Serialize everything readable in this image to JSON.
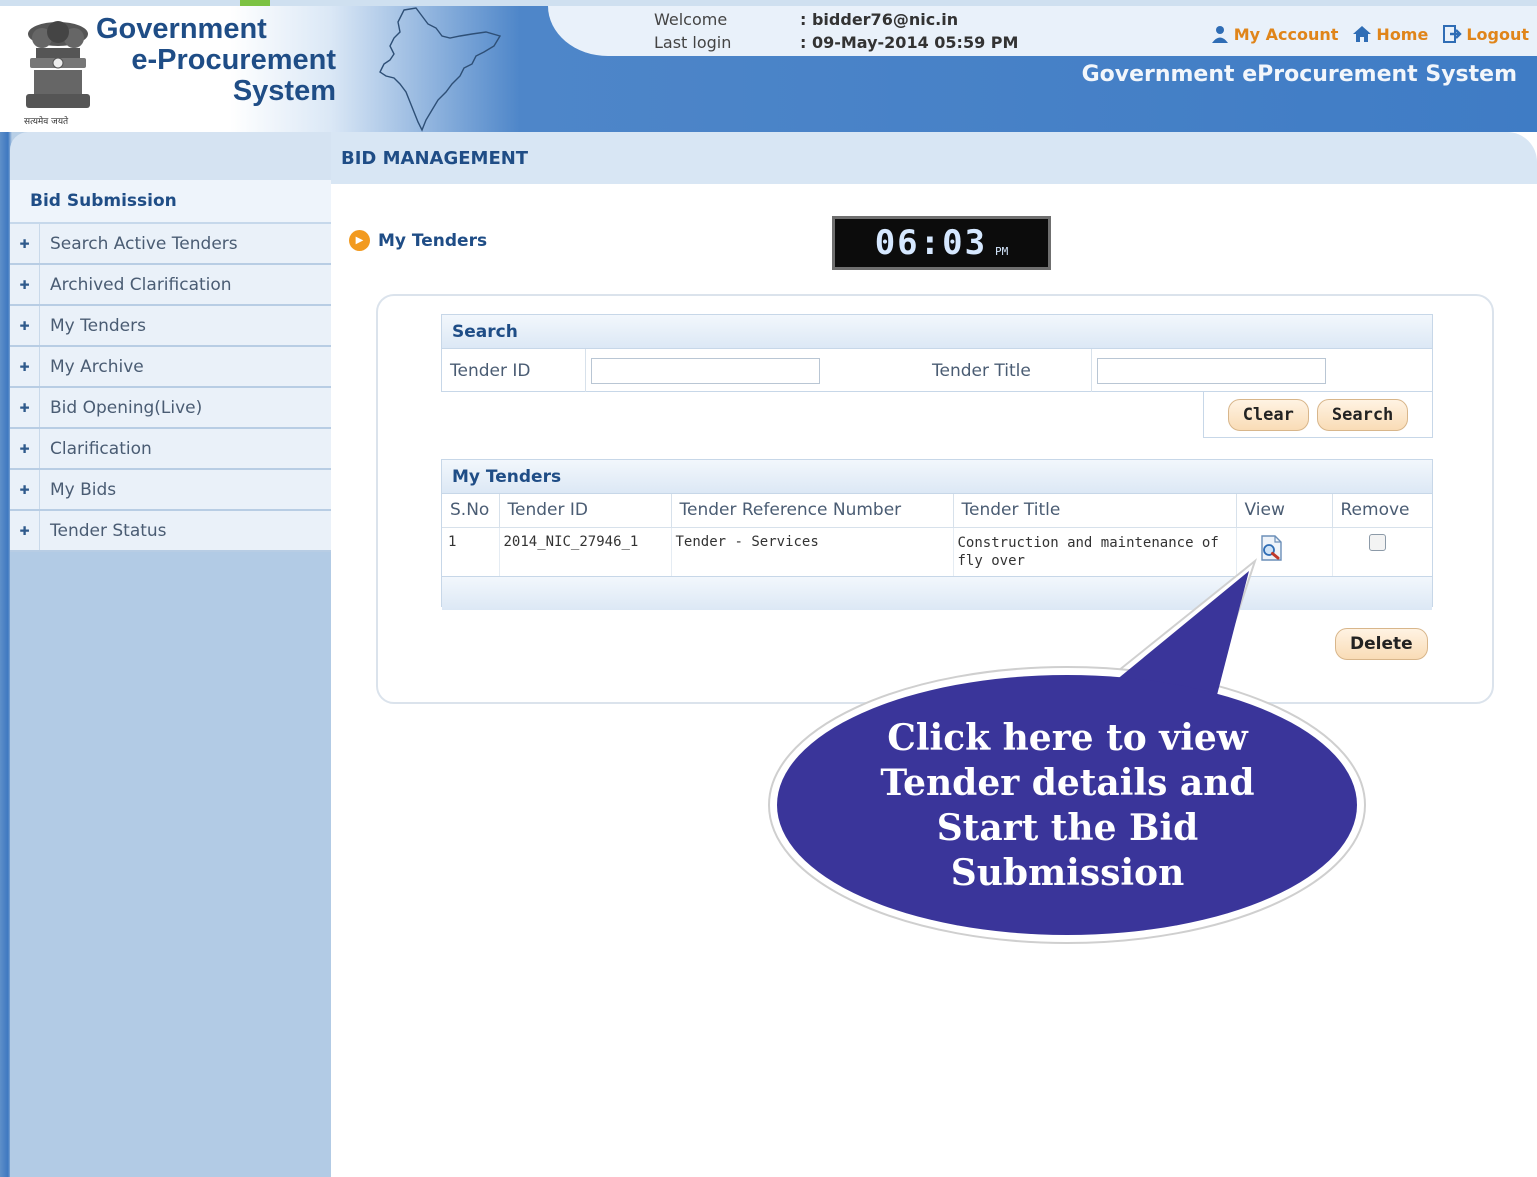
{
  "header": {
    "logo_line1": "Government",
    "logo_line2": "e-Procurement",
    "logo_line3": "System",
    "emblem_motto": "सत्यमेव जयते",
    "welcome_label": "Welcome",
    "welcome_value": ": bidder76@nic.in",
    "last_login_label": "Last login",
    "last_login_value": ": 09-May-2014 05:59 PM",
    "links": {
      "my_account": "My Account",
      "home": "Home",
      "logout": "Logout"
    },
    "system_title": "Government eProcurement System",
    "colors": {
      "link": "#e0851a",
      "brand": "#1f4d86"
    }
  },
  "sidebar": {
    "heading": "Bid Submission",
    "items": [
      {
        "label": "Search Active Tenders"
      },
      {
        "label": "Archived Clarification"
      },
      {
        "label": "My Tenders"
      },
      {
        "label": "My Archive"
      },
      {
        "label": "Bid Opening(Live)"
      },
      {
        "label": "Clarification"
      },
      {
        "label": "My Bids"
      },
      {
        "label": "Tender Status"
      }
    ],
    "bullet_icon": "arrow-right-icon"
  },
  "main": {
    "title": "BID MANAGEMENT",
    "section_title": "My Tenders",
    "clock": {
      "time": "06:03",
      "ampm": "PM"
    },
    "search": {
      "heading": "Search",
      "tender_id_label": "Tender ID",
      "tender_id_value": "",
      "tender_title_label": "Tender Title",
      "tender_title_value": "",
      "clear_label": "Clear",
      "search_label": "Search"
    },
    "tenders": {
      "heading": "My Tenders",
      "columns": [
        "S.No",
        "Tender ID",
        "Tender Reference Number",
        "Tender Title",
        "View",
        "Remove"
      ],
      "rows": [
        {
          "sno": "1",
          "tender_id": "2014_NIC_27946_1",
          "reference": "Tender - Services",
          "title": "Construction and maintenance of fly over",
          "view_icon": "view-document-icon",
          "remove_checked": false
        }
      ],
      "delete_label": "Delete"
    }
  },
  "callout": {
    "lines": [
      "Click here to view",
      "Tender details and",
      "Start the Bid",
      "Submission"
    ],
    "color": "#3a359a"
  }
}
